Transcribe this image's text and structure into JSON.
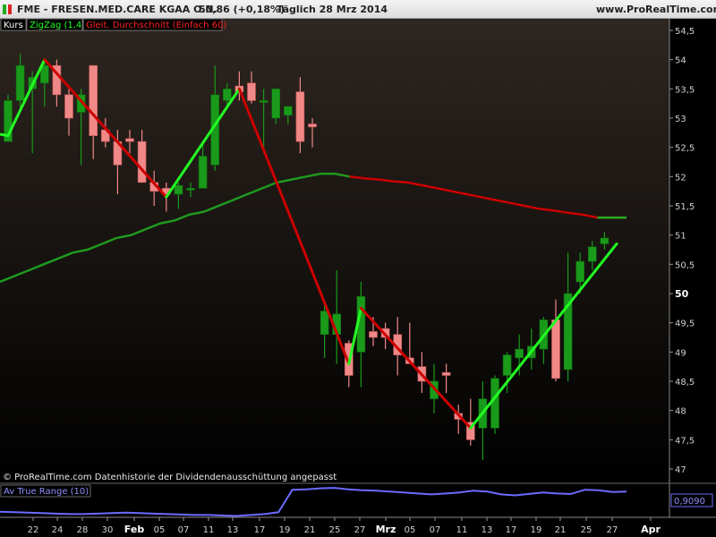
{
  "header": {
    "symbol": "FME - FRESEN.MED.CARE KGAA O.N.",
    "last": "50,86 (+0,18%)",
    "period": "Täglich  28 Mrz 2014",
    "site": "www.ProRealTime.com"
  },
  "legend": {
    "kurs": "Kurs",
    "zigzag": "ZigZag (1,4)",
    "ma": "Gleit. Durchschnitt (Einfach 60)"
  },
  "footer_note": "© ProRealTime.com  Datenhistorie der Dividendenausschüttung angepasst",
  "atr": {
    "label": "Av True Range (10)",
    "value": "0,9090"
  },
  "colors": {
    "up": "#1a9a1a",
    "down": "#f08888",
    "zig_up": "#22ff22",
    "zig_down": "#cc0000",
    "ma": "#cc0000",
    "ma_tail": "#22aa22",
    "atr": "#6b6bff",
    "bg_top": "#2e2620",
    "bg_bottom": "#000000"
  },
  "chart_data": [
    {
      "type": "candlestick",
      "ylim": [
        46.85,
        54.6
      ],
      "y_ticks": [
        "54,5",
        "54",
        "53,5",
        "53",
        "52,5",
        "52",
        "51,5",
        "51",
        "50,5",
        "50",
        "49,5",
        "49",
        "48,5",
        "48",
        "47,5",
        "47"
      ],
      "x_ticks": [
        "22",
        "24",
        "28",
        "30",
        "Feb",
        "05",
        "07",
        "11",
        "13",
        "17",
        "19",
        "21",
        "25",
        "27",
        "Mrz",
        "05",
        "07",
        "11",
        "13",
        "17",
        "19",
        "21",
        "25",
        "27",
        "Apr"
      ],
      "ohlc": [
        [
          52.6,
          53.4,
          52.7,
          53.3
        ],
        [
          53.3,
          54.1,
          53.1,
          53.9
        ],
        [
          53.5,
          53.8,
          52.4,
          53.7
        ],
        [
          53.6,
          54.0,
          53.2,
          53.9
        ],
        [
          53.9,
          54.0,
          53.2,
          53.4
        ],
        [
          53.4,
          53.5,
          52.7,
          53.0
        ],
        [
          53.1,
          53.5,
          52.2,
          53.4
        ],
        [
          53.9,
          53.9,
          52.3,
          52.7
        ],
        [
          52.8,
          53.0,
          52.5,
          52.6
        ],
        [
          52.6,
          52.8,
          51.7,
          52.2
        ],
        [
          52.65,
          52.8,
          52.4,
          52.6
        ],
        [
          52.6,
          52.8,
          51.9,
          51.9
        ],
        [
          51.9,
          52.1,
          51.5,
          51.75
        ],
        [
          51.8,
          51.9,
          51.4,
          51.7
        ],
        [
          51.7,
          51.9,
          51.45,
          51.85
        ],
        [
          51.8,
          51.9,
          51.65,
          51.8
        ],
        [
          51.8,
          52.6,
          51.8,
          52.35
        ],
        [
          52.2,
          53.9,
          52.1,
          53.4
        ],
        [
          53.3,
          53.6,
          53.2,
          53.5
        ],
        [
          53.55,
          53.8,
          53.3,
          53.45
        ],
        [
          53.6,
          53.8,
          53.25,
          53.3
        ],
        [
          53.3,
          53.5,
          52.4,
          53.3
        ],
        [
          53.0,
          53.5,
          52.9,
          53.5
        ],
        [
          53.05,
          53.2,
          52.9,
          53.2
        ],
        [
          53.45,
          53.7,
          52.4,
          52.6
        ],
        [
          52.9,
          53.0,
          52.5,
          52.85
        ],
        [
          49.3,
          49.8,
          48.9,
          49.7
        ],
        [
          49.3,
          50.4,
          48.8,
          49.65
        ],
        [
          49.15,
          49.2,
          48.4,
          48.6
        ],
        [
          49.0,
          50.2,
          48.4,
          49.95
        ],
        [
          49.35,
          49.6,
          49.1,
          49.25
        ],
        [
          49.4,
          49.5,
          49.05,
          49.25
        ],
        [
          49.3,
          49.6,
          48.6,
          48.95
        ],
        [
          48.9,
          49.5,
          48.8,
          48.8
        ],
        [
          48.75,
          49.0,
          48.3,
          48.5
        ],
        [
          48.2,
          48.8,
          47.95,
          48.5
        ],
        [
          48.65,
          48.8,
          48.3,
          48.6
        ],
        [
          47.95,
          48.1,
          47.6,
          47.85
        ],
        [
          47.8,
          48.2,
          47.4,
          47.5
        ],
        [
          47.7,
          48.5,
          47.15,
          48.2
        ],
        [
          47.7,
          48.6,
          47.6,
          48.55
        ],
        [
          48.6,
          49.0,
          48.3,
          48.95
        ],
        [
          48.9,
          49.3,
          48.6,
          49.05
        ],
        [
          48.9,
          49.4,
          48.7,
          49.1
        ],
        [
          49.05,
          49.6,
          48.8,
          49.55
        ],
        [
          49.55,
          49.9,
          48.5,
          48.55
        ],
        [
          48.7,
          50.7,
          48.5,
          50.0
        ],
        [
          50.2,
          50.7,
          50.0,
          50.55
        ],
        [
          50.55,
          50.9,
          50.4,
          50.8
        ],
        [
          50.85,
          51.05,
          50.75,
          50.95
        ]
      ],
      "zigzag": [
        [
          0,
          52.7
        ],
        [
          3,
          54.0
        ],
        [
          13,
          51.65
        ],
        [
          19,
          53.5
        ],
        [
          28,
          48.8
        ],
        [
          29,
          49.75
        ],
        [
          38,
          47.7
        ],
        [
          50,
          50.85
        ]
      ],
      "ma60": [
        50.2,
        50.3,
        50.4,
        50.5,
        50.6,
        50.7,
        50.75,
        50.85,
        50.95,
        51.0,
        51.1,
        51.2,
        51.25,
        51.35,
        51.4,
        51.5,
        51.6,
        51.7,
        51.8,
        51.9,
        51.95,
        52.0,
        52.05,
        52.05,
        52.0,
        51.97,
        51.95,
        51.92,
        51.9,
        51.85,
        51.8,
        51.75,
        51.7,
        51.65,
        51.6,
        51.55,
        51.5,
        51.45,
        51.42,
        51.38,
        51.35,
        51.3,
        51.3,
        51.3
      ]
    },
    {
      "type": "line",
      "name": "Av True Range (10)",
      "ylim": [
        0.35,
        1.0
      ],
      "values": [
        0.45,
        0.44,
        0.43,
        0.42,
        0.41,
        0.4,
        0.4,
        0.41,
        0.42,
        0.43,
        0.42,
        0.41,
        0.4,
        0.39,
        0.38,
        0.38,
        0.37,
        0.36,
        0.38,
        0.4,
        0.44,
        0.92,
        0.93,
        0.95,
        0.96,
        0.93,
        0.91,
        0.9,
        0.88,
        0.86,
        0.84,
        0.82,
        0.84,
        0.86,
        0.9,
        0.88,
        0.82,
        0.8,
        0.83,
        0.86,
        0.84,
        0.83,
        0.92,
        0.91,
        0.87,
        0.88
      ]
    }
  ]
}
